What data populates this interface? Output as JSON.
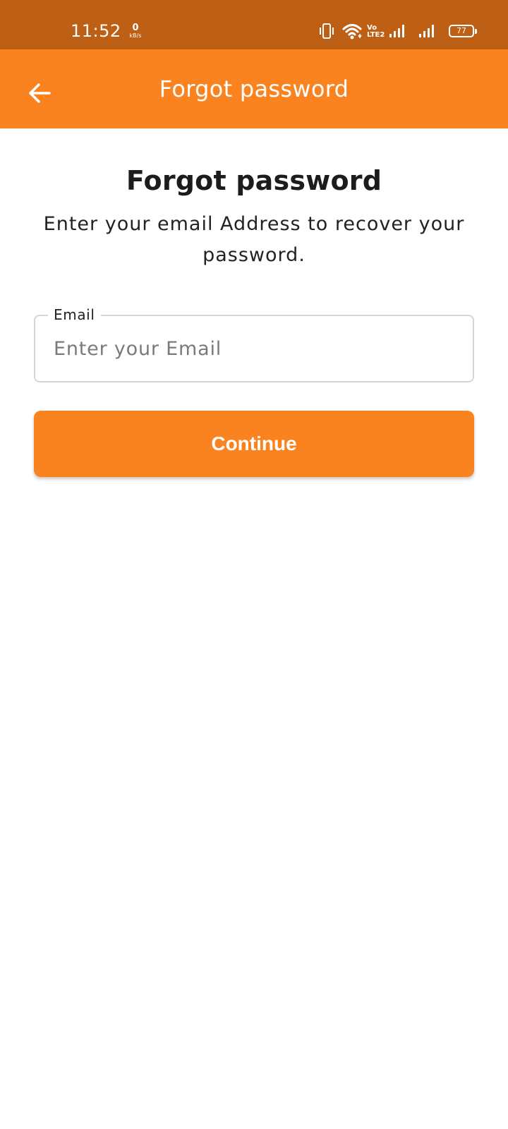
{
  "status_bar": {
    "time": "11:52",
    "net_speed_value": "0",
    "net_speed_unit": "kB/s",
    "volte_label": "Vo LTE2",
    "battery_level": "77",
    "icons": [
      "vibrate-icon",
      "wifi-icon",
      "volte-icon",
      "signal-icon",
      "signal-icon",
      "battery-icon"
    ]
  },
  "app_bar": {
    "title": "Forgot password",
    "back_icon": "arrow-back-icon"
  },
  "main": {
    "heading": "Forgot password",
    "subtitle": "Enter your email Address to recover your password.",
    "email_label": "Email",
    "email_placeholder": "Enter your Email",
    "email_value": "",
    "continue_label": "Continue"
  },
  "colors": {
    "status_bar": "#bd5f15",
    "accent": "#fb831f",
    "text_dark": "#1c1c1e",
    "placeholder": "#7a7a7a",
    "border": "#d6d6d6"
  }
}
